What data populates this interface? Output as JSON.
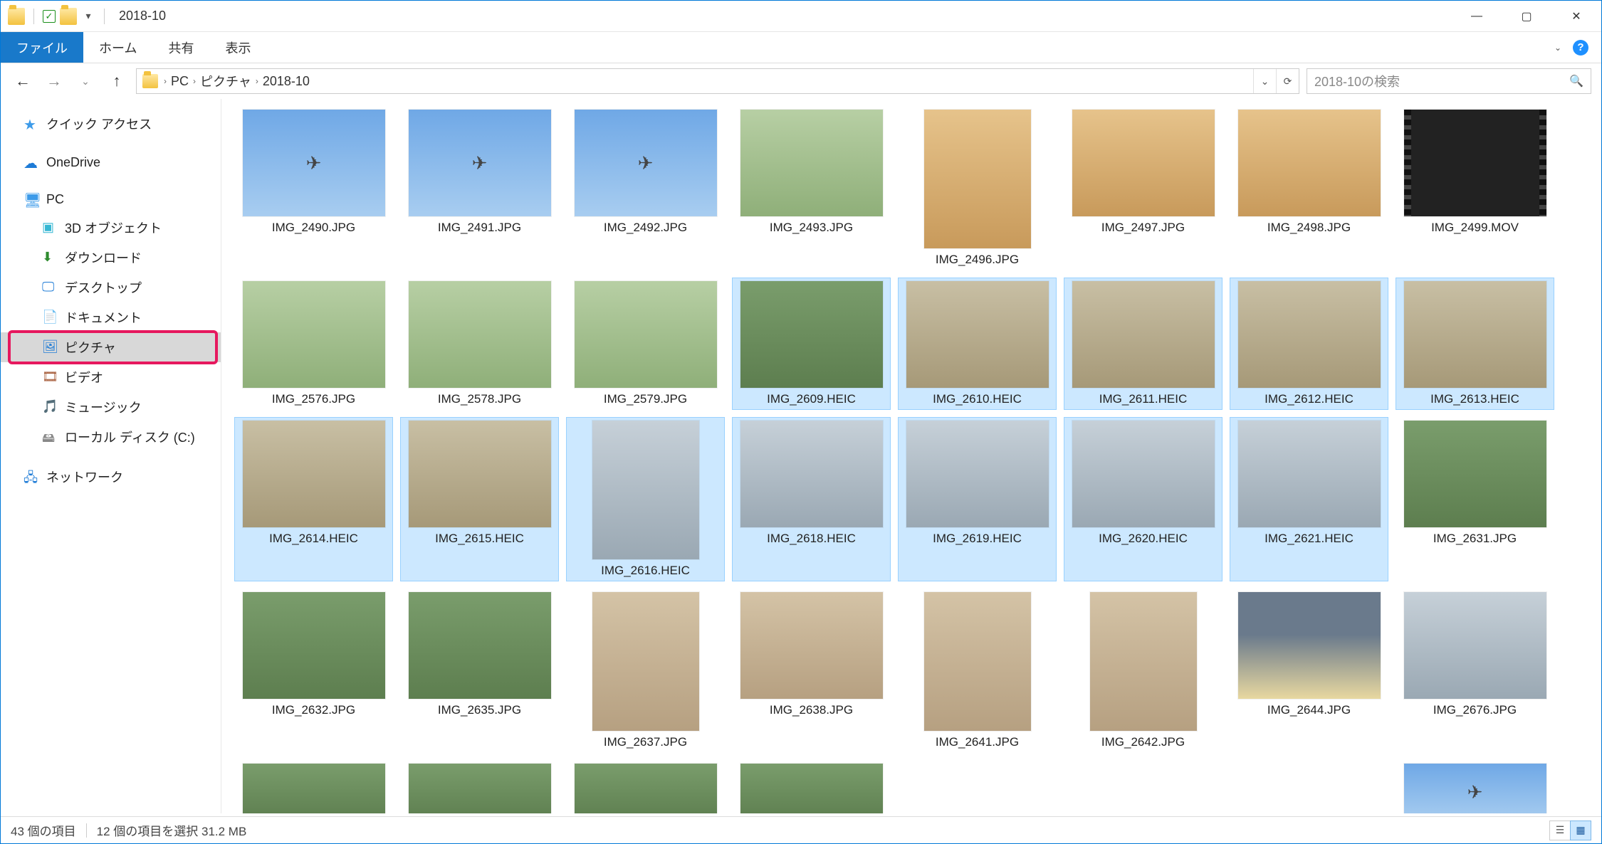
{
  "window": {
    "title": "2018-10"
  },
  "ribbon": {
    "file": "ファイル",
    "home": "ホーム",
    "share": "共有",
    "view": "表示"
  },
  "breadcrumb": {
    "p0": "PC",
    "p1": "ピクチャ",
    "p2": "2018-10"
  },
  "search": {
    "placeholder": "2018-10の検索"
  },
  "nav": {
    "quick": "クイック アクセス",
    "onedrive": "OneDrive",
    "pc": "PC",
    "obj3d": "3D オブジェクト",
    "downloads": "ダウンロード",
    "desktop": "デスクトップ",
    "documents": "ドキュメント",
    "pictures": "ピクチャ",
    "videos": "ビデオ",
    "music": "ミュージック",
    "disk": "ローカル ディスク (C:)",
    "network": "ネットワーク"
  },
  "files": {
    "r1": [
      "IMG_2490.JPG",
      "IMG_2491.JPG",
      "IMG_2492.JPG",
      "IMG_2493.JPG",
      "IMG_2496.JPG",
      "IMG_2497.JPG",
      "IMG_2498.JPG",
      "IMG_2499.MOV"
    ],
    "r2": [
      "IMG_2576.JPG",
      "IMG_2578.JPG",
      "IMG_2579.JPG",
      "IMG_2609.HEIC",
      "IMG_2610.HEIC",
      "IMG_2611.HEIC",
      "IMG_2612.HEIC",
      "IMG_2613.HEIC"
    ],
    "r3": [
      "IMG_2614.HEIC",
      "IMG_2615.HEIC",
      "IMG_2616.HEIC",
      "IMG_2618.HEIC",
      "IMG_2619.HEIC",
      "IMG_2620.HEIC",
      "IMG_2621.HEIC",
      "IMG_2631.JPG"
    ],
    "r4": [
      "IMG_2632.JPG",
      "IMG_2635.JPG",
      "IMG_2637.JPG",
      "IMG_2638.JPG",
      "IMG_2641.JPG",
      "IMG_2642.JPG",
      "IMG_2644.JPG",
      "IMG_2676.JPG"
    ]
  },
  "status": {
    "count": "43 個の項目",
    "selection": "12 個の項目を選択 31.2 MB"
  }
}
